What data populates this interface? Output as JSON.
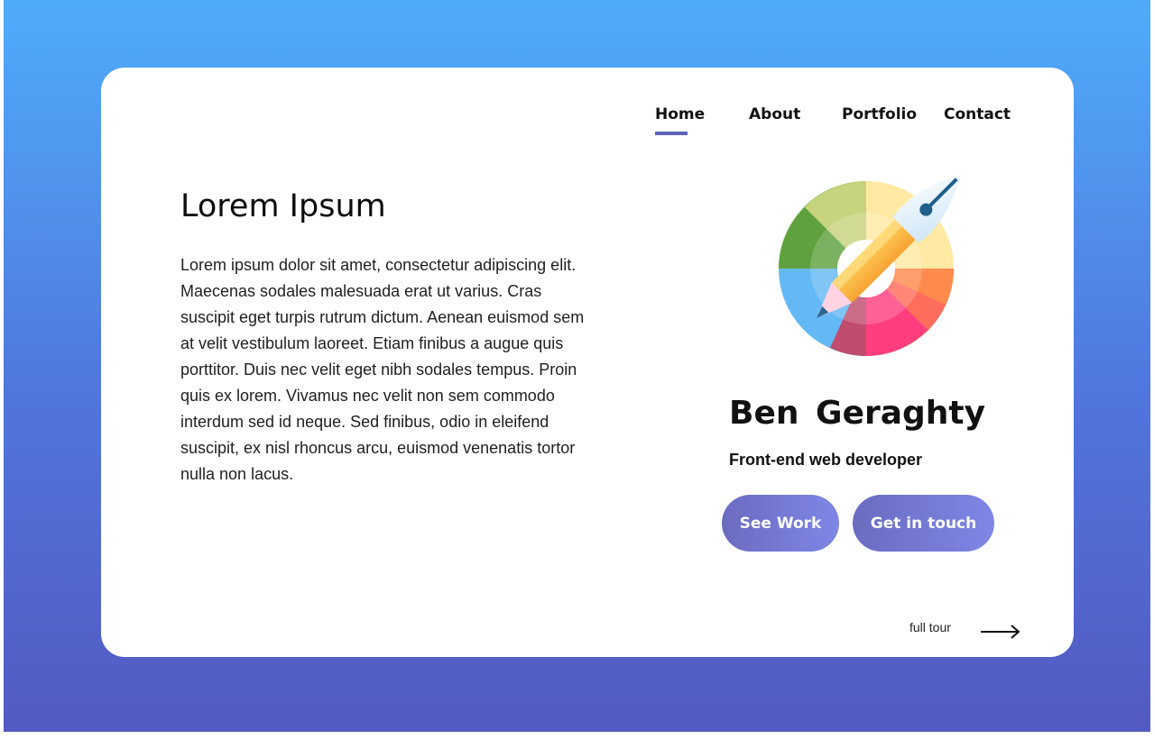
{
  "nav": {
    "items": [
      {
        "label": "Home",
        "active": true
      },
      {
        "label": "About",
        "active": false
      },
      {
        "label": "Portfolio",
        "active": false
      },
      {
        "label": "Contact",
        "active": false
      }
    ]
  },
  "hero": {
    "title": "Lorem Ipsum",
    "body": "Lorem ipsum dolor sit amet, consectetur adipiscing elit. Maecenas sodales malesuada erat ut varius. Cras suscipit eget turpis rutrum dictum. Aenean euismod sem at velit vestibulum laoreet. Etiam finibus a augue quis porttitor. Duis nec velit eget nibh sodales tempus. Proin quis ex lorem. Vivamus nec velit non sem commodo interdum sed id neque. Sed finibus, odio in eleifend suscipit, ex nisl rhoncus arcu, euismod venenatis tortor nulla non lacus."
  },
  "profile": {
    "logo_icon": "color-wheel-pen-pencil-icon",
    "name": "Ben  Geraghty",
    "role": "Front-end web developer"
  },
  "buttons": {
    "see_work": "See Work",
    "get_in_touch": "Get in touch"
  },
  "footer": {
    "tour_label": "full tour",
    "tour_icon": "arrow-right-icon"
  },
  "colors": {
    "background_top": "#4facfb",
    "background_bottom": "#535ac1",
    "accent": "#5e63b6",
    "button_start": "#6a6cbf",
    "button_end": "#7f86e6"
  }
}
